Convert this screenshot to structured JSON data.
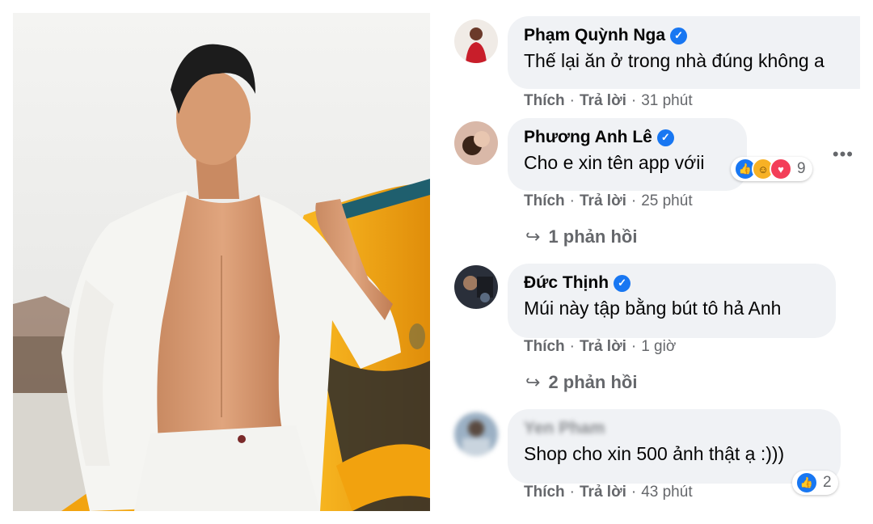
{
  "photo": {
    "description_icon": "man-with-surfboard-photo"
  },
  "actions": {
    "like": "Thích",
    "reply": "Trả lời",
    "dot": "·"
  },
  "comments": [
    {
      "name": "Phạm Quỳnh Nga",
      "verified": true,
      "text": "Thế lại ăn ở trong nhà đúng không a",
      "time": "31 phút"
    },
    {
      "name": "Phương Anh Lê",
      "verified": true,
      "text": "Cho e xin tên app vớii",
      "time": "25 phút",
      "reactions": {
        "icons": [
          "like-icon",
          "haha-icon",
          "love-icon"
        ],
        "count": "9"
      },
      "replies": "1 phản hồi"
    },
    {
      "name": "Đức Thịnh",
      "verified": true,
      "text": "Múi này tập bằng bút tô hả Anh",
      "time": "1 giờ",
      "replies": "2 phản hồi"
    },
    {
      "name": "Yen Pham",
      "verified": false,
      "text": "Shop cho xin 500 ảnh thật ạ :)))",
      "time": "43 phút",
      "reactions": {
        "icons": [
          "like-icon"
        ],
        "count": "2"
      }
    }
  ],
  "colors": {
    "bubble": "#f0f2f5",
    "meta": "#65676b",
    "verified": "#1877f2"
  }
}
